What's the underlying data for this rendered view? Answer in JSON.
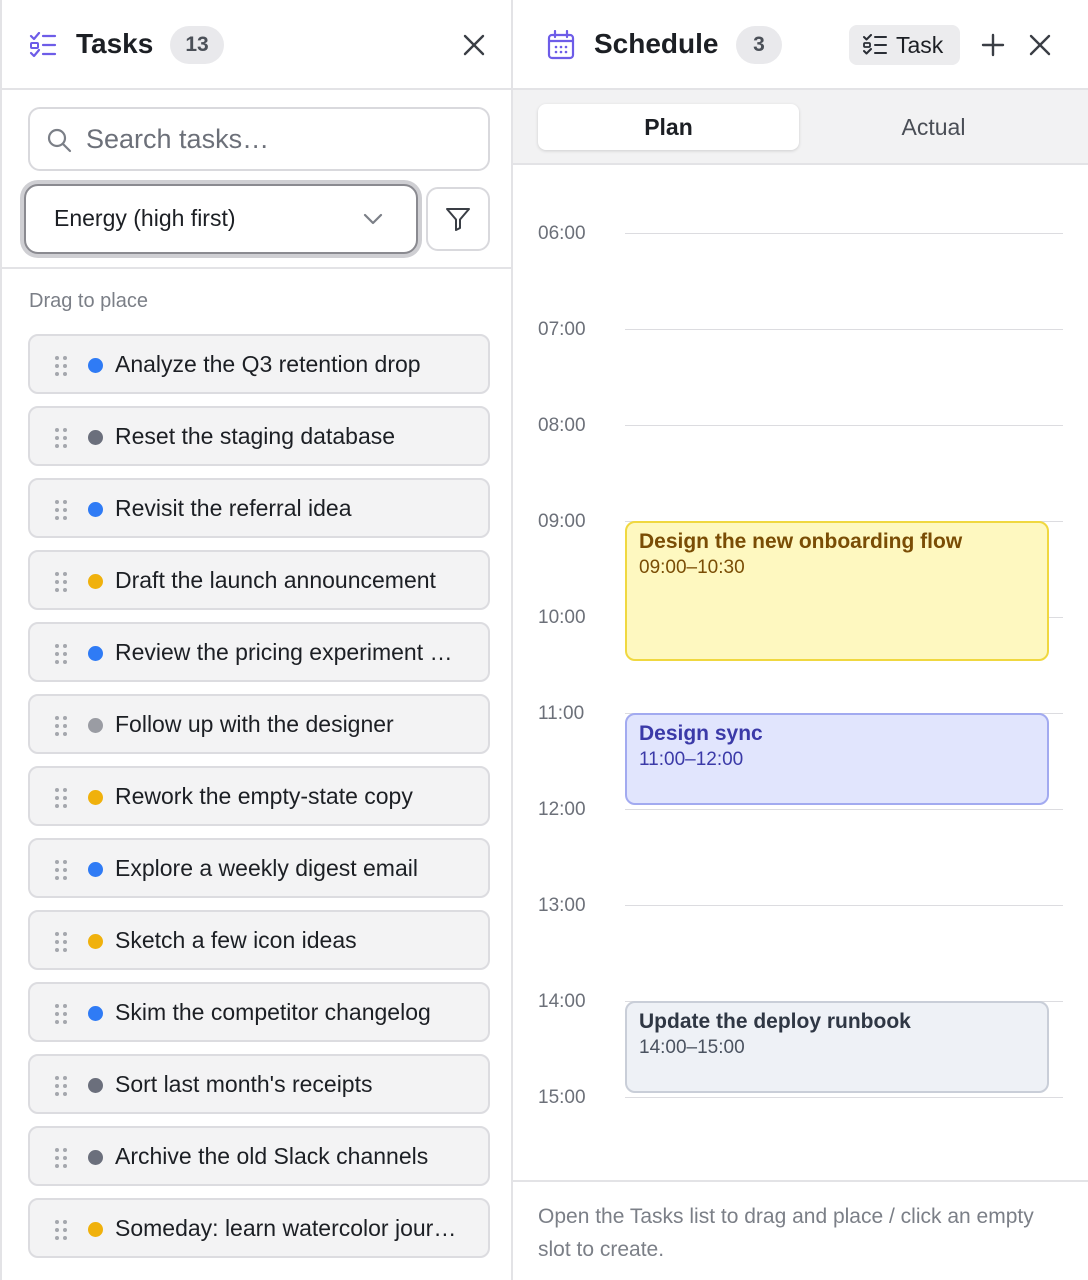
{
  "tasks_panel": {
    "title": "Tasks",
    "count": "13",
    "search": {
      "placeholder": "Search tasks…",
      "value": ""
    },
    "sort": {
      "selected": "Energy (high first)"
    },
    "drag_hint": "Drag to place",
    "items": [
      {
        "label": "Analyze the Q3 retention drop",
        "color": "#2f7bf5"
      },
      {
        "label": "Reset the staging database",
        "color": "#6b6f7c"
      },
      {
        "label": "Revisit the referral idea",
        "color": "#2f7bf5"
      },
      {
        "label": "Draft the launch announcement",
        "color": "#f0b10c"
      },
      {
        "label": "Review the pricing experiment …",
        "color": "#2f7bf5"
      },
      {
        "label": "Follow up with the designer",
        "color": "#9a9ca3"
      },
      {
        "label": "Rework the empty-state copy",
        "color": "#f0b10c"
      },
      {
        "label": "Explore a weekly digest email",
        "color": "#2f7bf5"
      },
      {
        "label": "Sketch a few icon ideas",
        "color": "#f0b10c"
      },
      {
        "label": "Skim the competitor changelog",
        "color": "#2f7bf5"
      },
      {
        "label": "Sort last month's receipts",
        "color": "#6b6f7c"
      },
      {
        "label": "Archive the old Slack channels",
        "color": "#6b6f7c"
      },
      {
        "label": "Someday: learn watercolor jour…",
        "color": "#f0b10c"
      }
    ]
  },
  "schedule_panel": {
    "title": "Schedule",
    "count": "3",
    "task_button_label": "Task",
    "tabs": {
      "plan": "Plan",
      "actual": "Actual",
      "active": "plan"
    },
    "hours": [
      "06:00",
      "07:00",
      "08:00",
      "09:00",
      "10:00",
      "11:00",
      "12:00",
      "13:00",
      "14:00",
      "15:00"
    ],
    "events": [
      {
        "title": "Design the new onboarding flow",
        "time": "09:00–10:30",
        "color": "yellow"
      },
      {
        "title": "Design sync",
        "time": "11:00–12:00",
        "color": "indigo"
      },
      {
        "title": "Update the deploy runbook",
        "time": "14:00–15:00",
        "color": "gray"
      }
    ],
    "footer_hint": "Open the Tasks list to drag and place / click an empty slot to create."
  }
}
